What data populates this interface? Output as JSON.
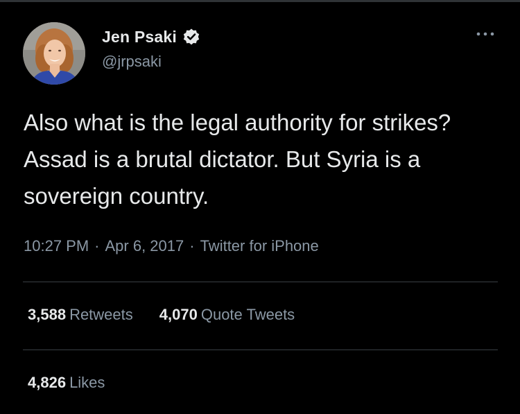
{
  "user": {
    "display_name": "Jen Psaki",
    "handle": "@jrpsaki",
    "verified": true,
    "avatar_icon": "profile-photo"
  },
  "tweet": {
    "text": "Also what is the legal authority for strikes? Assad is a brutal dictator. But Syria is a sovereign country.",
    "time": "10:27 PM",
    "date": "Apr 6, 2017",
    "source": "Twitter for iPhone",
    "separator": "·"
  },
  "stats": {
    "retweets_count": "3,588",
    "retweets_label": "Retweets",
    "quotes_count": "4,070",
    "quotes_label": "Quote Tweets",
    "likes_count": "4,826",
    "likes_label": "Likes"
  },
  "icons": {
    "verified": "verified-badge-icon",
    "more": "more-options-icon"
  },
  "colors": {
    "background": "#000000",
    "primary_text": "#e7e9ea",
    "secondary_text": "#8b98a5",
    "divider": "#3a3f44"
  }
}
